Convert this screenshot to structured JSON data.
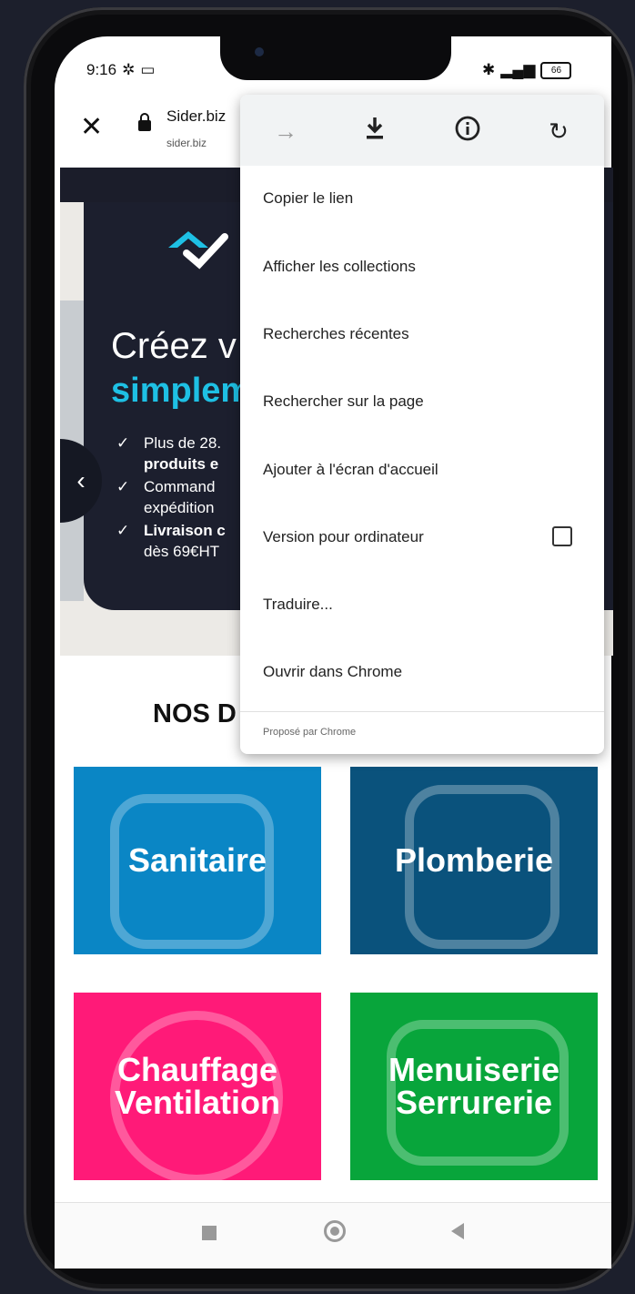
{
  "status_bar": {
    "time": "9:16",
    "battery": "66"
  },
  "browser": {
    "title": "Sider.biz",
    "url": "sider.biz"
  },
  "hero": {
    "heading_part1": "Créez v",
    "heading_part2": "simplem",
    "bullets": [
      "Plus de 28.",
      "produits e",
      "Command",
      "expédition",
      "Livraison c",
      "dès 69€HT"
    ]
  },
  "section_title": "NOS D",
  "categories": [
    {
      "line1": "Sanitaire",
      "line2": "",
      "color": "#0a86c5"
    },
    {
      "line1": "Plomberie",
      "line2": "",
      "color": "#0a527c"
    },
    {
      "line1": "Chauffage",
      "line2": "Ventilation",
      "color": "#ff1a78"
    },
    {
      "line1": "Menuiserie",
      "line2": "Serrurerie",
      "color": "#08a53b"
    }
  ],
  "menu": {
    "items": [
      "Copier le lien",
      "Afficher les collections",
      "Recherches récentes",
      "Rechercher sur la page",
      "Ajouter à l'écran d'accueil",
      "Version pour ordinateur",
      "Traduire...",
      "Ouvrir dans Chrome"
    ],
    "footer": "Proposé par Chrome",
    "icons": [
      "forward-icon",
      "download-icon",
      "info-icon",
      "refresh-icon"
    ]
  },
  "colors": {
    "accent": "#1ec0e4",
    "hero_bg": "#1c1f2e"
  }
}
